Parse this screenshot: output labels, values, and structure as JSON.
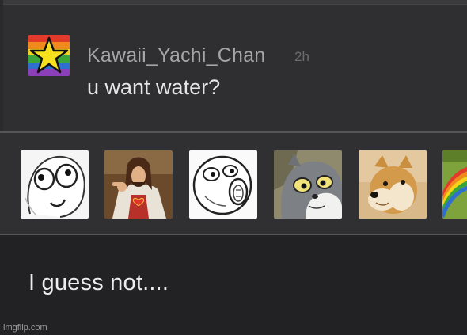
{
  "comment": {
    "username": "Kawaii_Yachi_Chan",
    "time": "2h",
    "text": "u want water?",
    "avatar_icon": "rainbow-star-icon"
  },
  "stickers": [
    {
      "name": "derp-meme-face"
    },
    {
      "name": "buddy-christ"
    },
    {
      "name": "lol-rage-face"
    },
    {
      "name": "unsettled-tom"
    },
    {
      "name": "doge"
    },
    {
      "name": "rainbow-sticker"
    }
  ],
  "reply": {
    "text": "I guess not...."
  },
  "watermark": "imgflip.com"
}
